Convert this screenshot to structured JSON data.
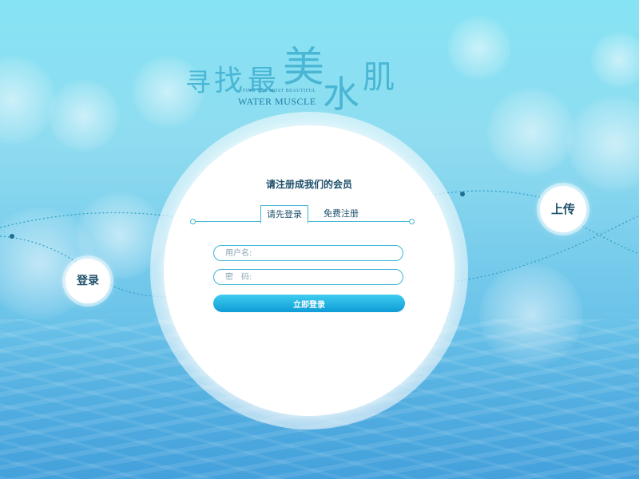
{
  "logo": {
    "chars": [
      "寻",
      "找",
      "最",
      "美",
      "水",
      "肌"
    ],
    "tagline_small": "FIND THE MOST BEAUTIFUL",
    "tagline": "WATER MUSCLE"
  },
  "card": {
    "title": "请注册成我们的会员",
    "tabs": [
      {
        "label": "请先登录",
        "active": true
      },
      {
        "label": "免费注册",
        "active": false
      }
    ],
    "username": {
      "placeholder": "用户名:"
    },
    "password": {
      "placeholder": "密　码:"
    },
    "submit_label": "立即登录"
  },
  "nodes": {
    "login_label": "登录",
    "upload_label": "上传"
  },
  "colors": {
    "accent": "#3fb7d4",
    "button_top": "#3ecdf0",
    "button_bottom": "#0f9bd6",
    "text_dark": "#1c4f6a",
    "logo_blue": "#3fb0cf"
  }
}
